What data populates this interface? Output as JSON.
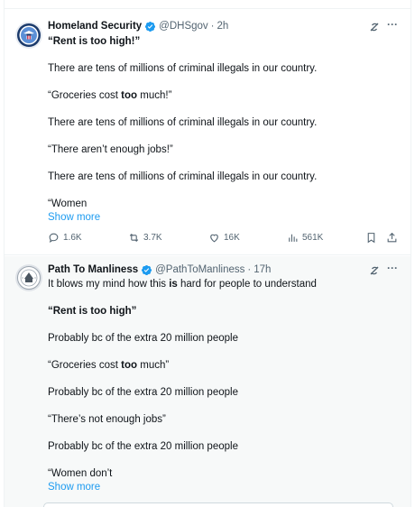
{
  "post1": {
    "author_name": "Homeland Security",
    "handle": "@DHSgov",
    "separator": "·",
    "time": "2h",
    "lines": [
      {
        "parts": [
          {
            "t": "“Rent is too high!”",
            "b": true
          }
        ]
      },
      {
        "parts": [
          {
            "t": "There are tens of millions of criminal illegals in our country.",
            "b": false
          }
        ]
      },
      {
        "parts": [
          {
            "t": "“Groceries cost ",
            "b": false
          },
          {
            "t": "too",
            "b": true
          },
          {
            "t": " much!”",
            "b": false
          }
        ]
      },
      {
        "parts": [
          {
            "t": "There are tens of millions of criminal illegals in our country.",
            "b": false
          }
        ]
      },
      {
        "parts": [
          {
            "t": "“There aren’t enough jobs!”",
            "b": false
          }
        ]
      },
      {
        "parts": [
          {
            "t": "There are tens of millions of criminal illegals in our country.",
            "b": false
          }
        ]
      },
      {
        "parts": [
          {
            "t": "“Women",
            "b": false
          }
        ]
      }
    ],
    "show_more": "Show more",
    "stats": {
      "replies": "1.6K",
      "reposts": "3.7K",
      "likes": "16K",
      "views": "561K"
    }
  },
  "post2": {
    "author_name": "Path To Manliness",
    "handle": "@PathToManliness",
    "separator": "·",
    "time": "17h",
    "lines": [
      {
        "parts": [
          {
            "t": "It blows my mind how this ",
            "b": false
          },
          {
            "t": "is",
            "b": true
          },
          {
            "t": " hard for people to understand",
            "b": false
          }
        ]
      },
      {
        "parts": [
          {
            "t": "“Rent is too high”",
            "b": true
          }
        ]
      },
      {
        "parts": [
          {
            "t": "Probably bc of the extra 20 million people",
            "b": false
          }
        ]
      },
      {
        "parts": [
          {
            "t": "“Groceries cost ",
            "b": false
          },
          {
            "t": "too",
            "b": true
          },
          {
            "t": " much”",
            "b": false
          }
        ]
      },
      {
        "parts": [
          {
            "t": "Probably bc of the extra 20 million people",
            "b": false
          }
        ]
      },
      {
        "parts": [
          {
            "t": "“There’s not enough jobs”",
            "b": false
          }
        ]
      },
      {
        "parts": [
          {
            "t": "Probably bc of the extra 20 million people",
            "b": false
          }
        ]
      },
      {
        "parts": [
          {
            "t": "“Women don’t",
            "b": false
          }
        ]
      }
    ],
    "show_more": "Show more"
  },
  "icons": {
    "verified": "verified-badge-icon",
    "grok": "grok-icon",
    "more": "more-icon",
    "reply": "reply-icon",
    "repost": "repost-icon",
    "like": "like-icon",
    "views": "views-icon",
    "bookmark": "bookmark-icon",
    "share": "share-icon"
  },
  "colors": {
    "accent": "#1d9bf0",
    "text": "#0f1419",
    "secondary": "#536471",
    "quoted_bg": "#f7f9f9"
  },
  "more_glyph": "···"
}
